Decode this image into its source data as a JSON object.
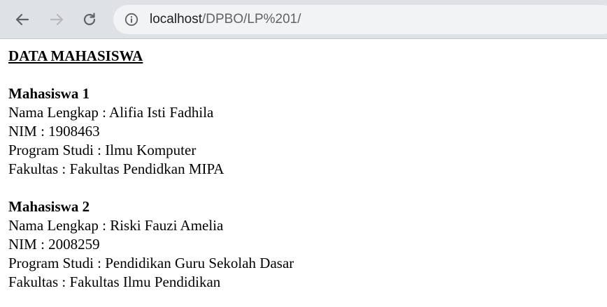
{
  "browser": {
    "url_host": "localhost",
    "url_path": "/DPBO/LP%201/",
    "icons": {
      "back": "arrow-left-icon",
      "forward": "arrow-right-icon",
      "reload": "reload-icon",
      "info": "info-icon"
    }
  },
  "page": {
    "heading": "DATA MAHASISWA",
    "students": [
      {
        "title": "Mahasiswa 1",
        "name_line": "Nama Lengkap : Alifia Isti Fadhila",
        "nim_line": "NIM : 1908463",
        "prodi_line": "Program Studi : Ilmu Komputer",
        "fakultas_line": "Fakultas : Fakultas Pendidkan MIPA"
      },
      {
        "title": "Mahasiswa 2",
        "name_line": "Nama Lengkap : Riski Fauzi Amelia",
        "nim_line": "NIM : 2008259",
        "prodi_line": "Program Studi : Pendidikan Guru Sekolah Dasar",
        "fakultas_line": "Fakultas : Fakultas Ilmu Pendidikan"
      }
    ]
  }
}
